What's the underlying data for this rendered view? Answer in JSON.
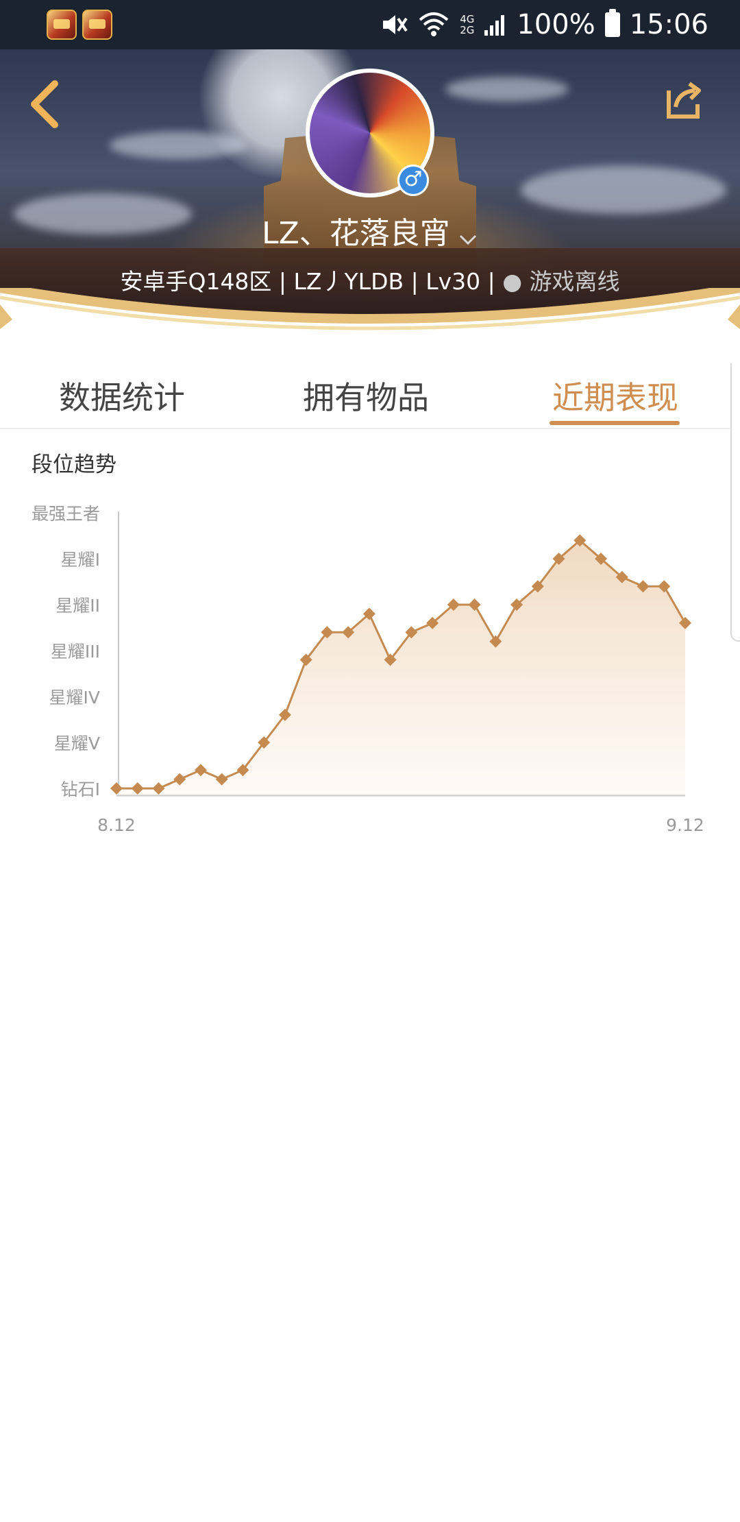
{
  "status_bar": {
    "battery": "100%",
    "time": "15:06",
    "network_top": "4G",
    "network_bottom": "2G"
  },
  "profile": {
    "nickname": "LZ、花落良宵",
    "meta": "安卓手Q148区 | LZ丿YLDB | Lv30 |",
    "status": "游戏离线",
    "gender_symbol": "♂"
  },
  "tabs": [
    {
      "label": "数据统计",
      "active": false
    },
    {
      "label": "拥有物品",
      "active": false
    },
    {
      "label": "近期表现",
      "active": true
    }
  ],
  "colors": {
    "accent": "#cf8d4f",
    "line": "#c58a4f",
    "fill": "#efd7bd"
  },
  "chart_data": {
    "type": "area",
    "title": "段位趋势",
    "y_levels": [
      "钻石I",
      "星耀V",
      "星耀IV",
      "星耀III",
      "星耀II",
      "星耀I",
      "最强王者"
    ],
    "x_start_label": "8.12",
    "x_end_label": "9.12",
    "values": [
      0,
      0,
      0,
      0.2,
      0.4,
      0.2,
      0.4,
      1.0,
      1.6,
      2.8,
      3.4,
      3.4,
      3.8,
      2.8,
      3.4,
      3.6,
      4.0,
      4.0,
      3.2,
      4.0,
      4.4,
      5.0,
      5.4,
      5.0,
      4.6,
      4.4,
      4.4,
      3.6
    ],
    "ylim": [
      0,
      6
    ],
    "grid": false
  }
}
